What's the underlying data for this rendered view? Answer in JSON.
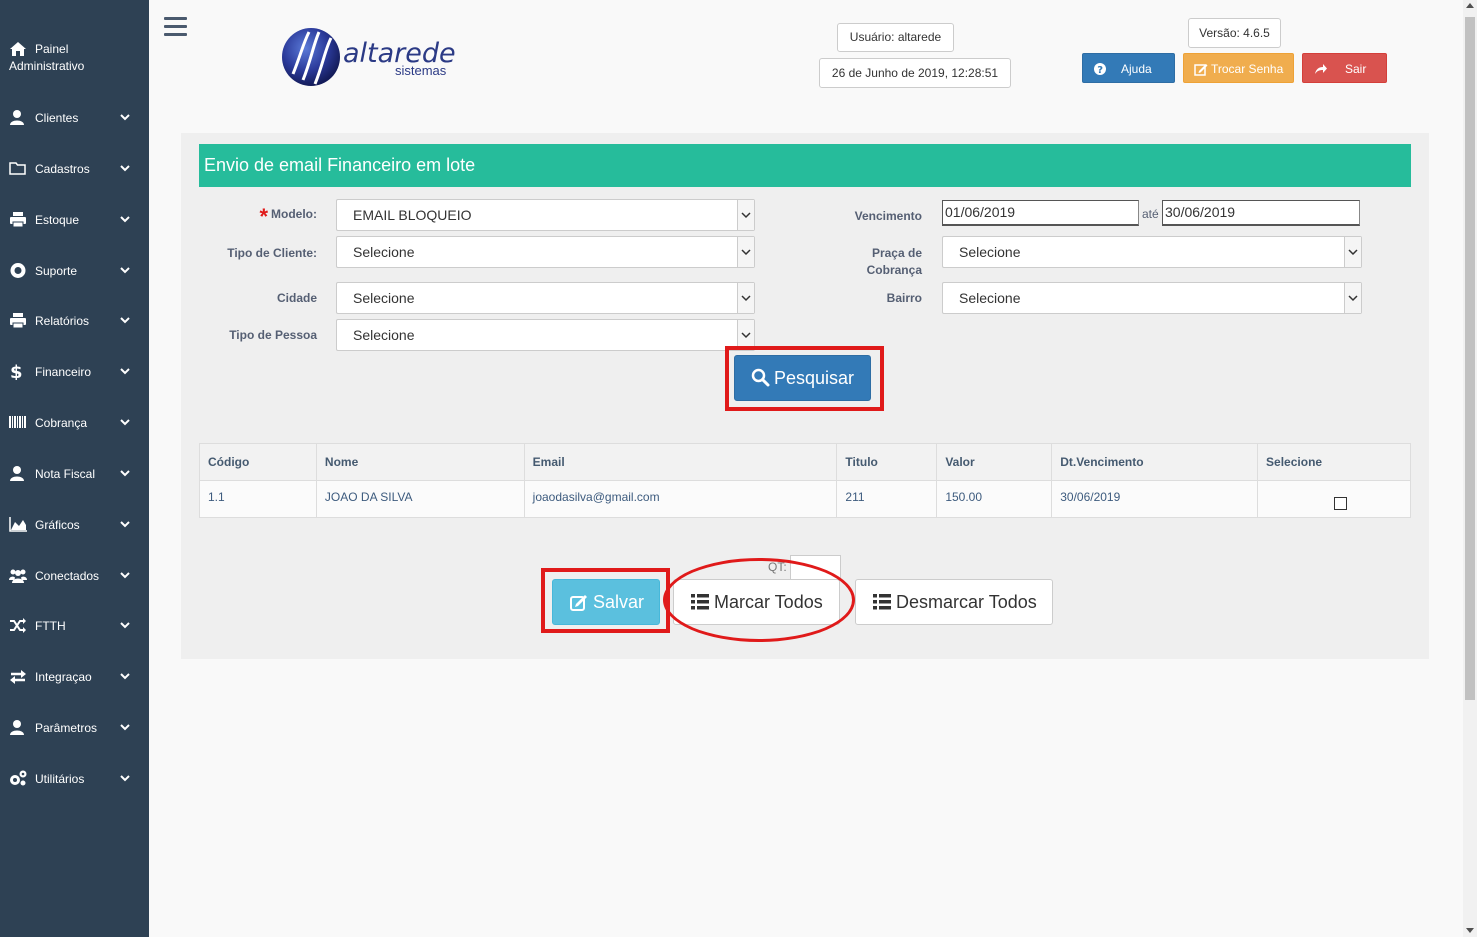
{
  "sidebar": {
    "brand_line1": "Painel",
    "brand_line2": "Administrativo",
    "items": [
      {
        "label": "Clientes",
        "icon": "user-icon"
      },
      {
        "label": "Cadastros",
        "icon": "folder-icon"
      },
      {
        "label": "Estoque",
        "icon": "printer-icon"
      },
      {
        "label": "Suporte",
        "icon": "lifebuoy-icon"
      },
      {
        "label": "Relatórios",
        "icon": "printer-icon"
      },
      {
        "label": "Financeiro",
        "icon": "dollar-icon"
      },
      {
        "label": "Cobrança",
        "icon": "barcode-icon"
      },
      {
        "label": "Nota Fiscal",
        "icon": "user-icon"
      },
      {
        "label": "Gráficos",
        "icon": "area-chart-icon"
      },
      {
        "label": "Conectados",
        "icon": "users-icon"
      },
      {
        "label": "FTTH",
        "icon": "random-icon"
      },
      {
        "label": "Integraçao",
        "icon": "exchange-icon"
      },
      {
        "label": "Parâmetros",
        "icon": "user-icon"
      },
      {
        "label": "Utilitários",
        "icon": "cogs-icon"
      }
    ]
  },
  "header": {
    "logo_name": "altarede",
    "logo_sub": "sistemas",
    "user": "Usuário: altarede",
    "datetime": "26 de Junho de 2019, 12:28:51",
    "version": "Versão: 4.6.5",
    "help_label": "Ajuda",
    "change_password_label": "Trocar Senha",
    "logout_label": "Sair"
  },
  "form": {
    "title": "Envio de email Financeiro em lote",
    "modelo_label": "Modelo:",
    "modelo_value": "EMAIL BLOQUEIO",
    "tipo_cliente_label": "Tipo de Cliente:",
    "tipo_cliente_value": "Selecione",
    "cidade_label": "Cidade",
    "cidade_value": "Selecione",
    "tipo_pessoa_label": "Tipo de Pessoa",
    "tipo_pessoa_value": "Selecione",
    "vencimento_label": "Vencimento",
    "vencimento_from": "01/06/2019",
    "ate_label": "até",
    "vencimento_to": "30/06/2019",
    "praca_label_1": "Praça de",
    "praca_label_2": "Cobrança",
    "praca_value": "Selecione",
    "bairro_label": "Bairro",
    "bairro_value": "Selecione",
    "search_label": "Pesquisar"
  },
  "table": {
    "headers": [
      "Código",
      "Nome",
      "Email",
      "Titulo",
      "Valor",
      "Dt.Vencimento",
      "Selecione"
    ],
    "rows": [
      {
        "codigo": "1.1",
        "nome": "JOAO DA SILVA",
        "email": "joaodasilva@gmail.com",
        "titulo": "211",
        "valor": "150.00",
        "vencimento": "30/06/2019"
      }
    ]
  },
  "actions": {
    "qt_label": "QT:",
    "save_label": "Salvar",
    "mark_all_label": "Marcar Todos",
    "unmark_all_label": "Desmarcar Todos"
  },
  "colors": {
    "sidebar_bg": "#2e4154",
    "title_bar": "#26bc9b",
    "primary": "#337ab7",
    "warning": "#f0ad4e",
    "danger": "#d9534f",
    "info": "#5bc0de",
    "annotation": "#e01a1a"
  }
}
